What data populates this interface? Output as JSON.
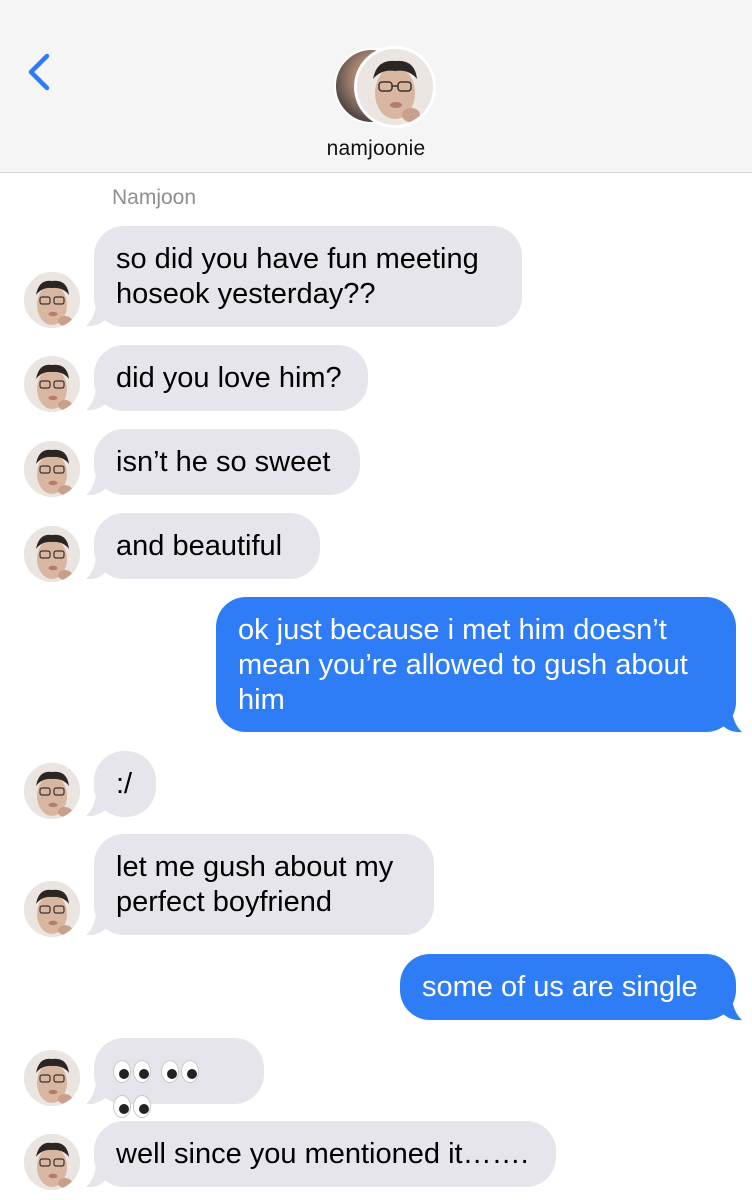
{
  "header": {
    "contact_name": "namjoonie"
  },
  "conversation": {
    "sender_label": "Namjoon",
    "messages": [
      {
        "from": "them",
        "text": "so did you have fun meeting hoseok yesterday??"
      },
      {
        "from": "them",
        "text": "did you love him?"
      },
      {
        "from": "them",
        "text": "isn’t he so sweet"
      },
      {
        "from": "them",
        "text": "and beautiful"
      },
      {
        "from": "me",
        "text": "ok just because i met him doesn’t mean you’re allowed to gush about him"
      },
      {
        "from": "them",
        "text": ":/"
      },
      {
        "from": "them",
        "text": "let me gush about my perfect boyfriend"
      },
      {
        "from": "me",
        "text": "some of us are single"
      },
      {
        "from": "them",
        "text": "👀👀👀"
      },
      {
        "from": "them",
        "text": "well since you mentioned it……."
      }
    ]
  },
  "colors": {
    "incoming_bubble": "#e6e5eb",
    "outgoing_bubble": "#2f7df6",
    "accent_back": "#2f7df6",
    "header_bg": "#f6f5f5"
  },
  "icons": {
    "back": "chevron-left-icon",
    "eyes": "eyes-emoji-icon"
  }
}
